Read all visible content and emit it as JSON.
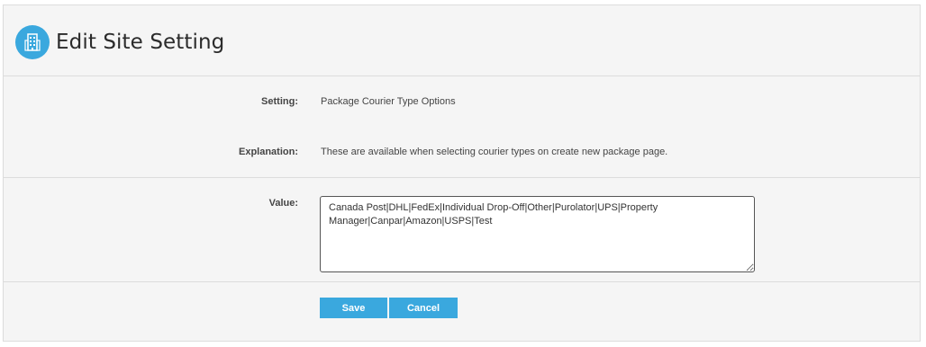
{
  "header": {
    "title": "Edit Site Setting",
    "icon": "building-icon",
    "icon_bg": "#3aa8de"
  },
  "form": {
    "setting_label": "Setting:",
    "setting_value": "Package Courier Type Options",
    "explanation_label": "Explanation:",
    "explanation_value": "These are available when selecting courier types on create new package page.",
    "value_label": "Value:",
    "value_text": "Canada Post|DHL|FedEx|Individual Drop-Off|Other|Purolator|UPS|Property Manager|Canpar|Amazon|USPS|Test"
  },
  "actions": {
    "save_label": "Save",
    "cancel_label": "Cancel",
    "button_color": "#3aa8de"
  }
}
